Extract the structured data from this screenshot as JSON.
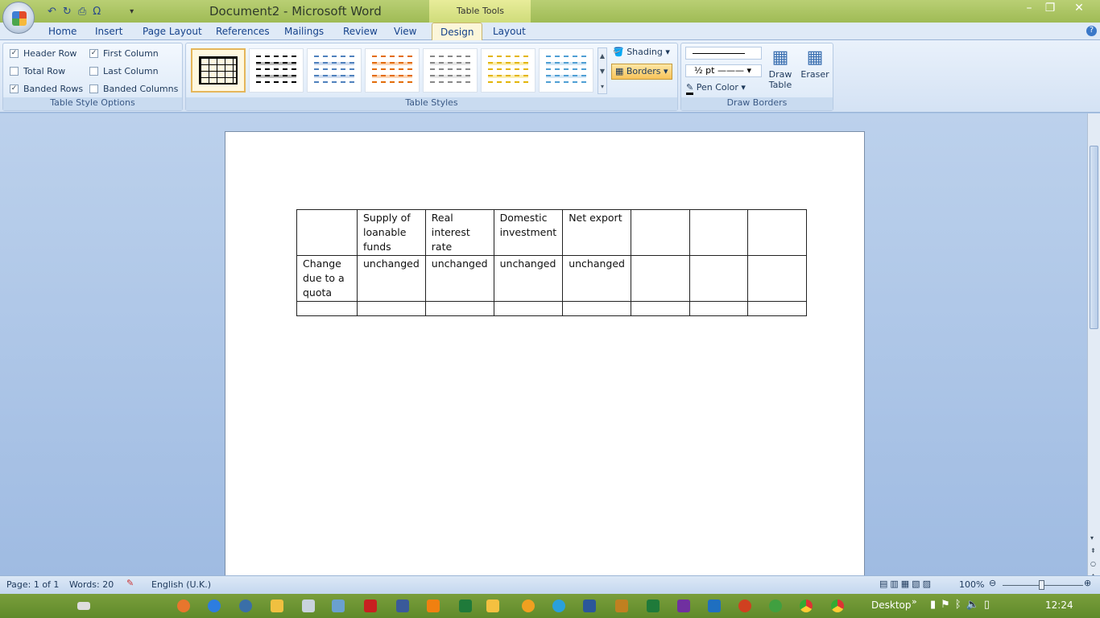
{
  "title": "Document2 - Microsoft Word",
  "contextual_tab": "Table Tools",
  "tabs": [
    "Home",
    "Insert",
    "Page Layout",
    "References",
    "Mailings",
    "Review",
    "View",
    "Design",
    "Layout"
  ],
  "active_tab": "Design",
  "style_options": {
    "header_row": {
      "label": "Header Row",
      "checked": true
    },
    "total_row": {
      "label": "Total Row",
      "checked": false
    },
    "banded_rows": {
      "label": "Banded Rows",
      "checked": true
    },
    "first_column": {
      "label": "First Column",
      "checked": true
    },
    "last_column": {
      "label": "Last Column",
      "checked": false
    },
    "banded_columns": {
      "label": "Banded Columns",
      "checked": false
    },
    "group_label": "Table Style Options"
  },
  "table_styles": {
    "group_label": "Table Styles",
    "shading": "Shading",
    "borders": "Borders",
    "colors": [
      "#000000",
      "#444444",
      "#4f81bd",
      "#e36c09",
      "#808080",
      "#e3b50a",
      "#4f9fd4"
    ]
  },
  "draw_borders": {
    "group_label": "Draw Borders",
    "line_weight": "½ pt",
    "pen_color": "Pen Color",
    "draw_table": "Draw Table",
    "eraser": "Eraser"
  },
  "table": {
    "rows": [
      [
        "",
        "Supply of loanable funds",
        "Real interest rate",
        "Domestic investment",
        "Net export",
        "",
        "",
        ""
      ],
      [
        "Change due to a quota",
        "unchanged",
        "unchanged",
        "unchanged",
        "unchanged",
        "",
        "",
        ""
      ],
      [
        "",
        "",
        "",
        "",
        "",
        "",
        "",
        ""
      ]
    ]
  },
  "status": {
    "page": "Page: 1 of 1",
    "words": "Words: 20",
    "language": "English (U.K.)",
    "zoom": "100%"
  },
  "taskbar": {
    "desktop": "Desktop",
    "clock": "12:24"
  }
}
